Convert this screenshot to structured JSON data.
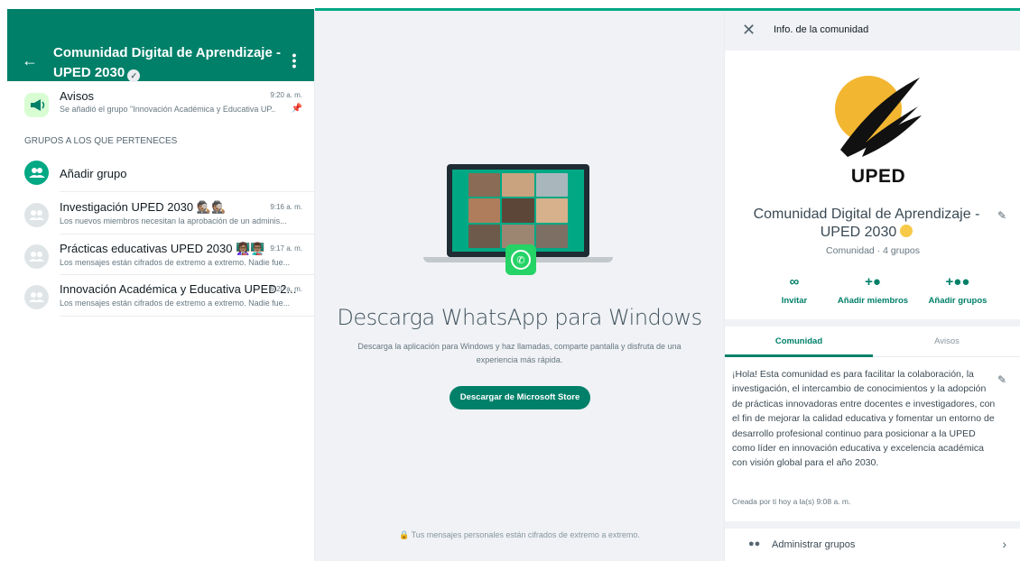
{
  "colors": {
    "brand": "#008069",
    "accent": "#00a884",
    "whatsapp_green": "#25d366",
    "uped_yellow": "#f2b631"
  },
  "left_panel": {
    "header": {
      "title": "Comunidad Digital de Aprendizaje - UPED 2030",
      "back_icon": "arrow-left-icon",
      "menu_icon": "kebab-menu-icon"
    },
    "announcements": {
      "title": "Avisos",
      "time": "9:20 a. m.",
      "preview": "Se añadió el grupo \"Innovación Académica y Educativa UP...",
      "icon": "megaphone-icon"
    },
    "section_label": "GRUPOS A LOS QUE PERTENECES",
    "add_group_label": "Añadir grupo",
    "groups": [
      {
        "title": "Investigación UPED 2030 🕵🏽🕵🏽",
        "time": "9:16 a. m.",
        "preview": "Los nuevos miembros necesitan la aprobación de un adminis..."
      },
      {
        "title": "Prácticas educativas UPED 2030 👩🏽‍🏫👨🏽‍🏫",
        "time": "9:17 a. m.",
        "preview": "Los mensajes están cifrados de extremo a extremo. Nadie fue..."
      },
      {
        "title": "Innovación Académica y Educativa UPED 2...",
        "time": "9:20 a. m.",
        "preview": "Los mensajes están cifrados de extremo a extremo. Nadie fue..."
      }
    ]
  },
  "middle": {
    "title": "Descarga WhatsApp para Windows",
    "description": "Descarga la aplicación para Windows y haz llamadas, comparte pantalla y disfruta de una experiencia más rápida.",
    "button": "Descargar de Microsoft Store",
    "footer": "Tus mensajes personales están cifrados de extremo a extremo."
  },
  "right_panel": {
    "header_title": "Info. de la comunidad",
    "logo_text": "UPED",
    "community_name": "Comunidad Digital de Aprendizaje - UPED 2030",
    "meta": "Comunidad · 4 grupos",
    "actions": [
      {
        "label": "Invitar",
        "icon": "link-icon"
      },
      {
        "label": "Añadir miembros",
        "icon": "add-person-icon"
      },
      {
        "label": "Añadir grupos",
        "icon": "add-group-icon"
      }
    ],
    "tabs": [
      "Comunidad",
      "Avisos"
    ],
    "description": "¡Hola! Esta comunidad es para facilitar la colaboración, la investigación, el intercambio de conocimientos y la adopción de prácticas innovadoras entre docentes e investigadores, con el fin de mejorar la calidad educativa y fomentar un entorno de desarrollo profesional continuo para posicionar a la UPED como líder en innovación educativa y excelencia académica con visión global para el año 2030.",
    "created": "Creada por ti hoy a la(s) 9:08 a. m.",
    "manage_label": "Administrar grupos"
  }
}
